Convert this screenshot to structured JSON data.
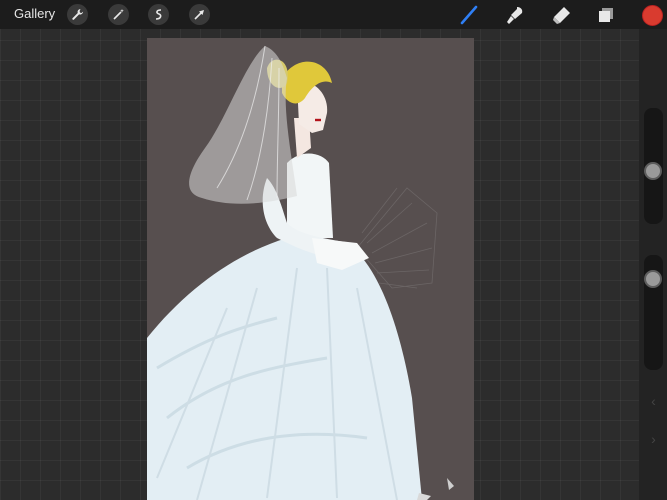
{
  "toolbar": {
    "gallery_label": "Gallery",
    "left_tools": [
      "wrench-icon",
      "magic-wand-icon",
      "selection-icon",
      "transform-icon"
    ],
    "right_tools": [
      "brush-icon",
      "smudge-icon",
      "eraser-icon",
      "layers-icon"
    ],
    "active_tool": "brush-icon",
    "accent_color": "#2f7ff5",
    "current_color": "#d93b2f"
  },
  "sidebar": {
    "brush_size_level": 0.45,
    "opacity_level": 0.85,
    "undo_icon": "undo-icon",
    "redo_icon": "redo-icon"
  },
  "canvas": {
    "background_color": "#574f4f"
  }
}
